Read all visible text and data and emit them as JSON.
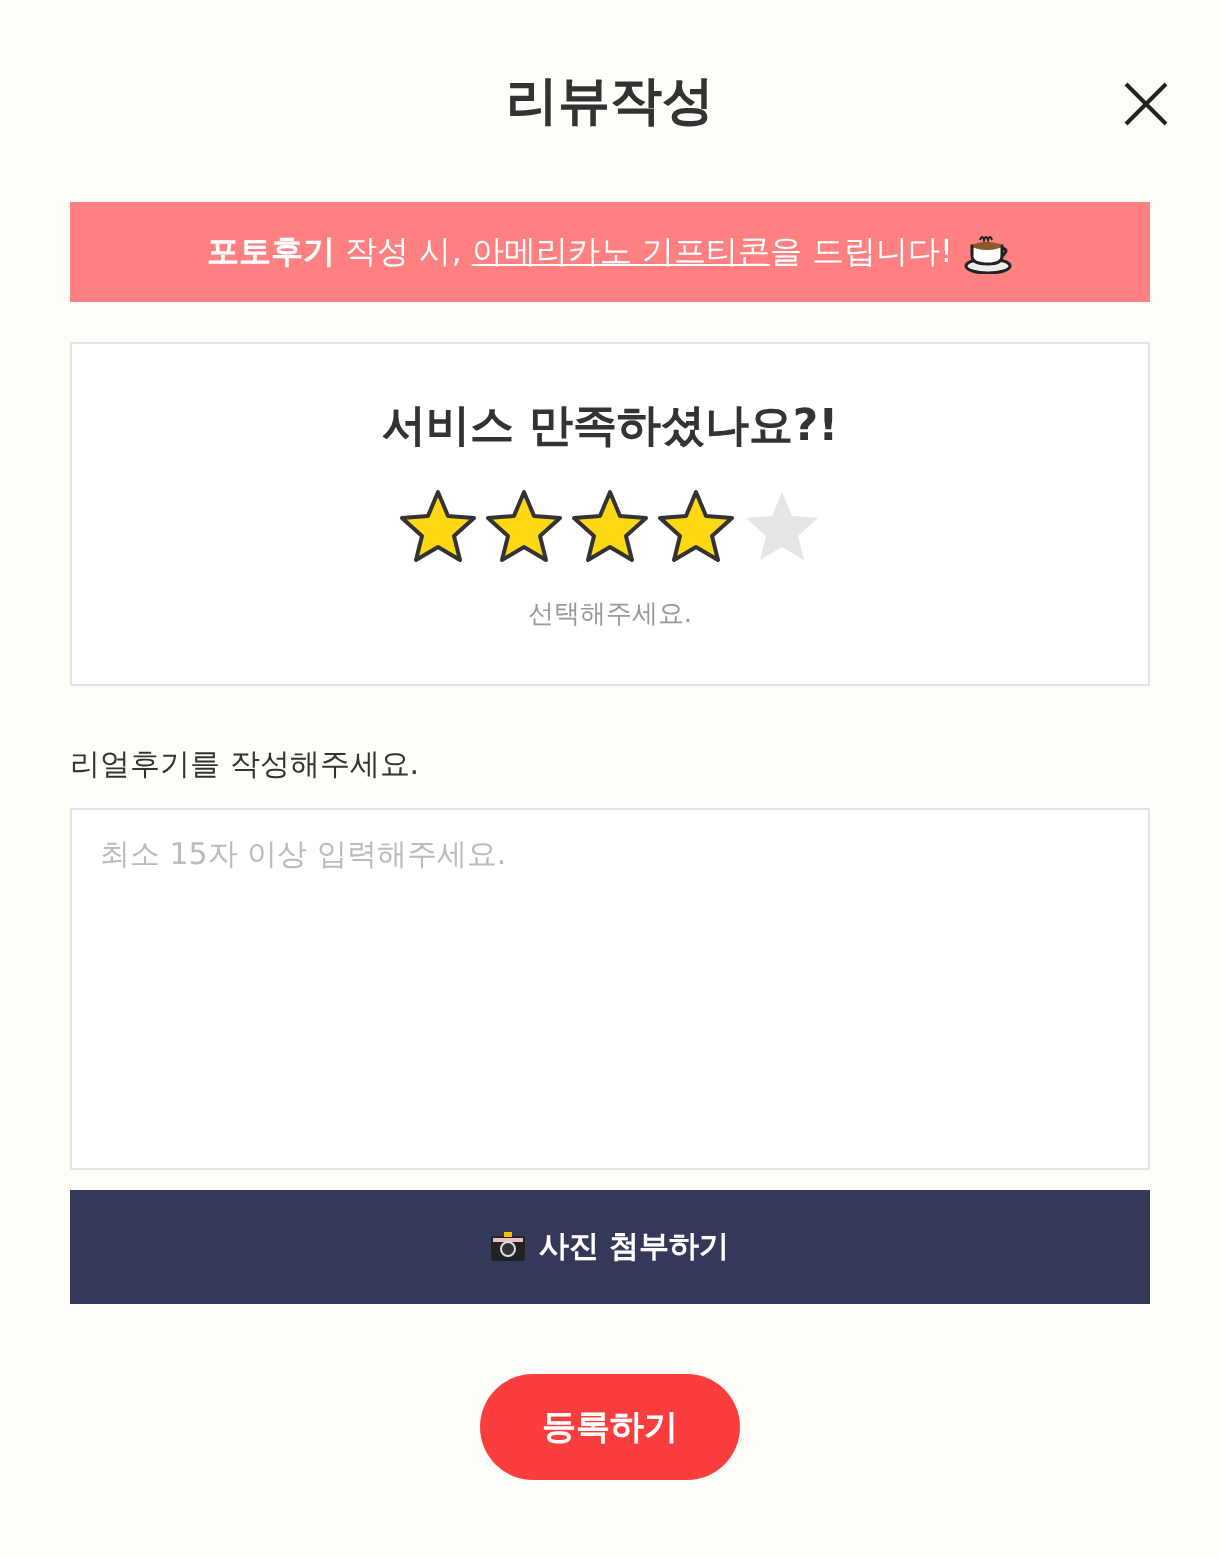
{
  "dialog": {
    "title": "리뷰작성"
  },
  "banner": {
    "prefix": "**포토후기** 작성 시, ",
    "link": "아메리카노 기프티콘",
    "suffix": "을 드립니다!"
  },
  "rating": {
    "question": "서비스 만족하셨나요?!",
    "stars": 4,
    "hint": "선택해주세요."
  },
  "review": {
    "label": "리얼후기를 작성해주세요.",
    "placeholder": "최소 15자 이상 입력해주세요."
  },
  "photo_button": "사진 첨부하기",
  "submit_button": "등록하기"
}
